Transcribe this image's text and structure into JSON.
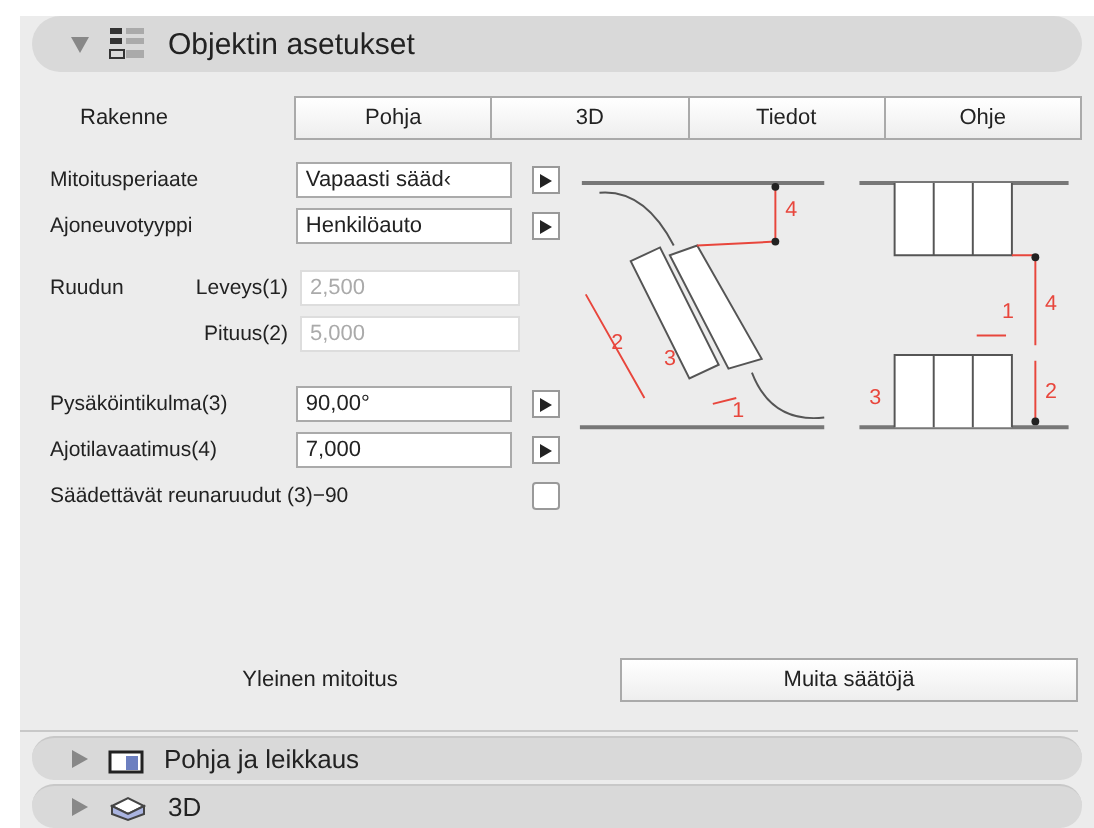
{
  "header": {
    "title": "Objektin asetukset",
    "expanded": true
  },
  "tabs_label": "Rakenne",
  "tabs": [
    {
      "label": "Pohja",
      "selected": false
    },
    {
      "label": "3D",
      "selected": false
    },
    {
      "label": "Tiedot",
      "selected": false
    },
    {
      "label": "Ohje",
      "selected": false
    }
  ],
  "fields": [
    {
      "kind": "menu",
      "label": "Mitoitusperiaate",
      "value": "Vapaasti sääd‹"
    },
    {
      "kind": "menu",
      "label": "Ajoneuvotyyppi",
      "value": "Henkilöauto"
    },
    {
      "kind": "group",
      "label": "Ruudun",
      "items": [
        {
          "label": "Leveys(1)",
          "value": "2,500",
          "disabled": true
        },
        {
          "label": "Pituus(2)",
          "value": "5,000",
          "disabled": true
        }
      ]
    },
    {
      "kind": "menu",
      "label": "Pysäköintikulma(3)",
      "value": "90,00°"
    },
    {
      "kind": "menu",
      "label": "Ajotilavaatimus(4)",
      "value": "7,000"
    },
    {
      "kind": "checkbox",
      "label": "Säädettävät reunaruudut (3)−90",
      "checked": false
    }
  ],
  "diagram": {
    "left_labels": [
      "4",
      "2",
      "3",
      "1"
    ],
    "right_labels": [
      "1",
      "4",
      "3",
      "2"
    ]
  },
  "footer": {
    "label": "Yleinen mitoitus",
    "button": "Muita säätöjä"
  },
  "sections": [
    {
      "title": "Pohja ja leikkaus",
      "expanded": false
    },
    {
      "title": "3D",
      "expanded": false
    }
  ]
}
